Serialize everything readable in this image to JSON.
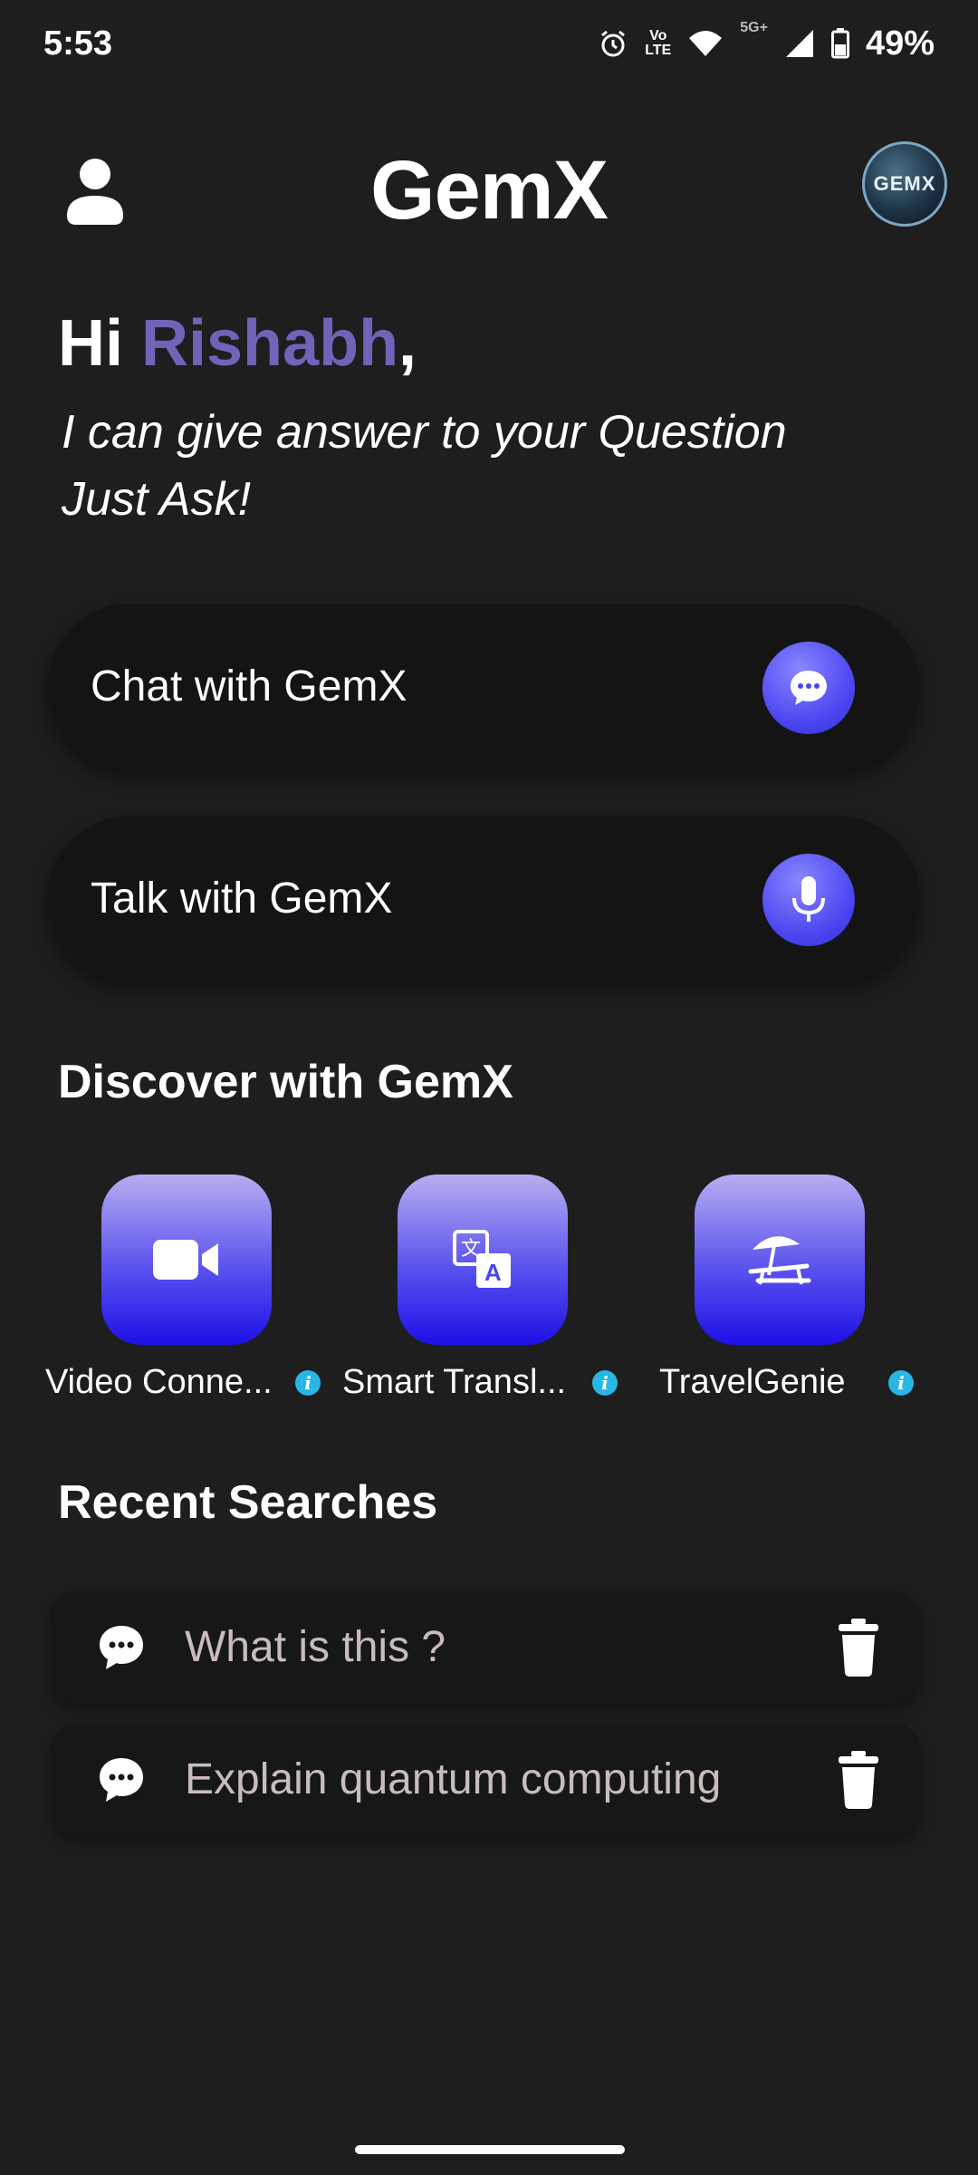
{
  "status_bar": {
    "time": "5:53",
    "lte_top": "Vo",
    "lte_bottom": "LTE",
    "network": "5G+",
    "battery": "49%"
  },
  "header": {
    "title": "GemX",
    "logo_text": "GEMX"
  },
  "greeting": {
    "prefix": "Hi",
    "name": "Rishabh",
    "suffix": ",",
    "subtitle_line1": "I can give answer to your Question",
    "subtitle_line2": "Just Ask!"
  },
  "actions": [
    {
      "label": "Chat with GemX",
      "icon": "chat-bubble-icon"
    },
    {
      "label": "Talk with GemX",
      "icon": "microphone-icon"
    }
  ],
  "discover": {
    "title": "Discover with GemX",
    "items": [
      {
        "label": "Video Conne...",
        "icon": "video-camera-icon"
      },
      {
        "label": "Smart Transl...",
        "icon": "translate-icon"
      },
      {
        "label": "TravelGenie",
        "icon": "beach-umbrella-icon"
      }
    ]
  },
  "recent": {
    "title": "Recent Searches",
    "items": [
      {
        "query": "What is this ?"
      },
      {
        "query": "Explain quantum computing"
      }
    ]
  },
  "colors": {
    "background": "#1e1e1f",
    "accent_name": "#6f64b8",
    "button_blue": "#4a45f0",
    "info_blue": "#28b6e6"
  }
}
